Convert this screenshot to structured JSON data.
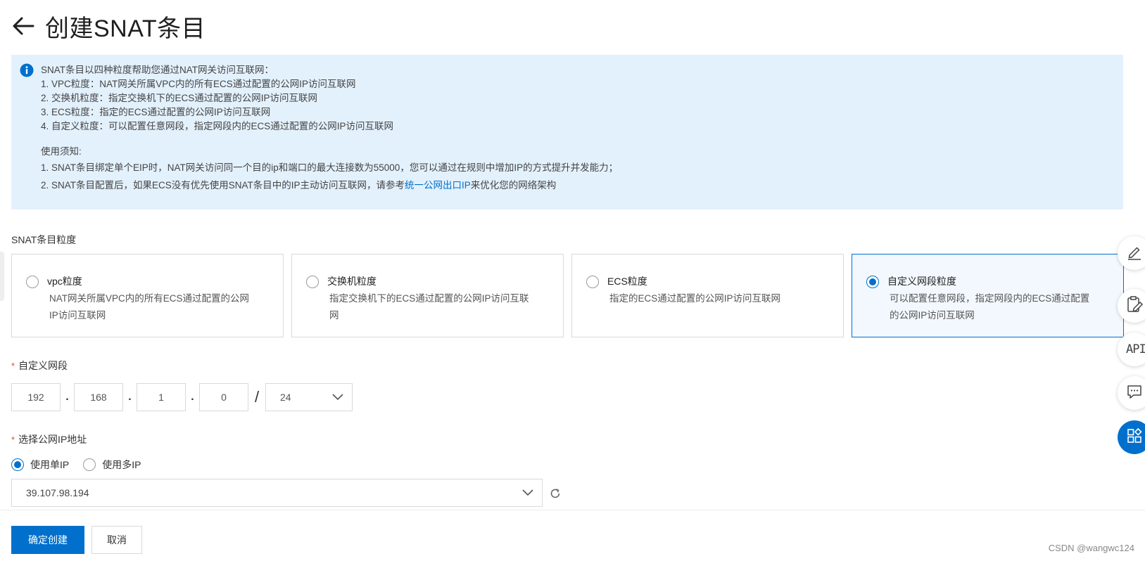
{
  "header": {
    "title": "创建SNAT条目"
  },
  "notice": {
    "lines": [
      "SNAT条目以四种粒度帮助您通过NAT网关访问互联网：",
      "1. VPC粒度：NAT网关所属VPC内的所有ECS通过配置的公网IP访问互联网",
      "2. 交换机粒度：指定交换机下的ECS通过配置的公网IP访问互联网",
      "3. ECS粒度：指定的ECS通过配置的公网IP访问互联网",
      "4. 自定义粒度：可以配置任意网段，指定网段内的ECS通过配置的公网IP访问互联网"
    ],
    "usage_title": "使用须知:",
    "usage_line1": "1. SNAT条目绑定单个EIP时，NAT网关访问同一个目的ip和端口的最大连接数为55000，您可以通过在规则中增加IP的方式提升并发能力；",
    "usage_line2_prefix": "2. SNAT条目配置后，如果ECS没有优先使用SNAT条目中的IP主动访问互联网，请参考",
    "usage_line2_link": "统一公网出口IP",
    "usage_line2_suffix": "来优化您的网络架构"
  },
  "granularity": {
    "label": "SNAT条目粒度",
    "options": [
      {
        "title": "vpc粒度",
        "desc1": "NAT网关所属VPC内的所有ECS通过配置的公网",
        "desc2": "IP访问互联网",
        "selected": false
      },
      {
        "title": "交换机粒度",
        "desc1": "指定交换机下的ECS通过配置的公网IP访问互联",
        "desc2": "网",
        "selected": false
      },
      {
        "title": "ECS粒度",
        "desc1": "指定的ECS通过配置的公网IP访问互联网",
        "desc2": "",
        "selected": false
      },
      {
        "title": "自定义网段粒度",
        "desc1": "可以配置任意网段，指定网段内的ECS通过配置",
        "desc2": "的公网IP访问互联网",
        "selected": true
      }
    ]
  },
  "cidr": {
    "label": "自定义网段",
    "octets": [
      "192",
      "168",
      "1",
      "0"
    ],
    "mask": "24"
  },
  "public_ip": {
    "label": "选择公网IP地址",
    "mode_single": "使用单IP",
    "mode_multi": "使用多IP",
    "selected_mode": "single",
    "selected_ip": "39.107.98.194"
  },
  "footer": {
    "confirm": "确定创建",
    "cancel": "取消"
  },
  "float_tools": {
    "api_label": "API"
  },
  "watermark": "CSDN @wangwc124",
  "colors": {
    "primary": "#0070cc",
    "notice_bg": "#e3f1fd",
    "required": "#e34d2f"
  }
}
